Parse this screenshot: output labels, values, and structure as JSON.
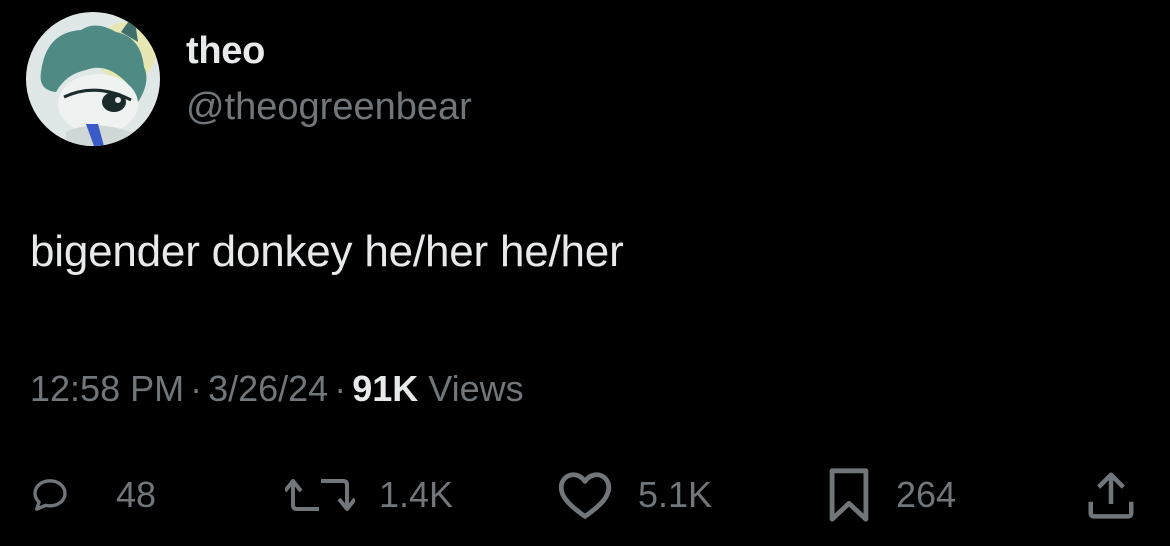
{
  "author": {
    "display_name": "theo",
    "handle": "@theogreenbear",
    "avatar_icon": "cartoon-avatar-icon"
  },
  "tweet": {
    "text": "bigender donkey he/her he/her"
  },
  "meta": {
    "time": "12:58 PM",
    "separator": "·",
    "date": "3/26/24",
    "views_count": "91K",
    "views_label": "Views"
  },
  "actions": {
    "replies": "48",
    "reposts": "1.4K",
    "likes": "5.1K",
    "bookmarks": "264"
  },
  "colors": {
    "background": "#000000",
    "primary_text": "#e7e9ea",
    "secondary_text": "#71767b"
  }
}
